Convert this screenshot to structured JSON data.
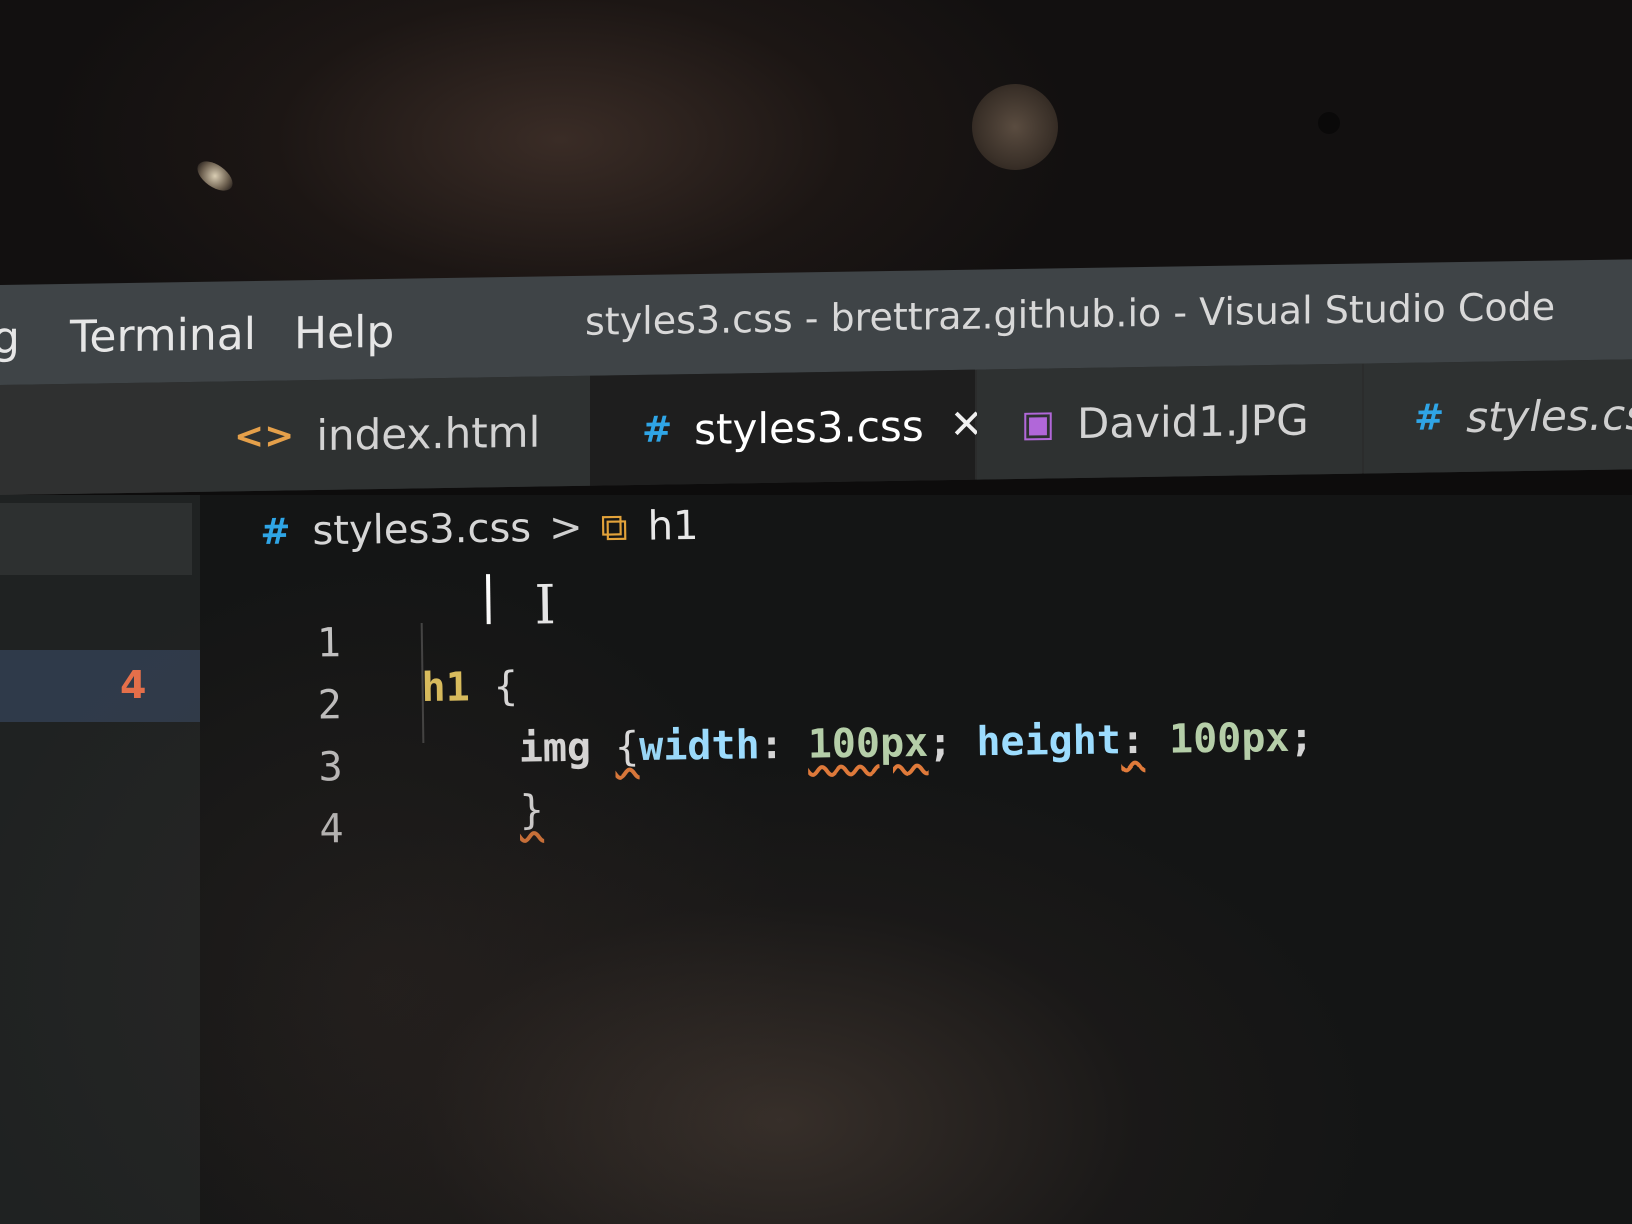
{
  "menu": {
    "items": [
      {
        "label": "g"
      },
      {
        "label": "Terminal"
      },
      {
        "label": "Help"
      }
    ]
  },
  "window": {
    "title": "styles3.css - brettraz.github.io - Visual Studio Code"
  },
  "tabs": [
    {
      "label": "index.html",
      "icon": "<>",
      "icon_name": "html-file-icon",
      "active": false
    },
    {
      "label": "styles3.css",
      "icon": "#",
      "icon_name": "css-file-icon",
      "active": true,
      "close_glyph": "✕"
    },
    {
      "label": "David1.JPG",
      "icon": "▣",
      "icon_name": "image-file-icon",
      "active": false
    },
    {
      "label": "styles.css",
      "icon": "#",
      "icon_name": "css-file-icon",
      "active": false,
      "preview": true
    }
  ],
  "sidebar": {
    "badge": "4"
  },
  "breadcrumb": {
    "icon": "#",
    "file": "styles3.css",
    "separator": ">",
    "symbol_icon": "⧉",
    "symbol": "h1"
  },
  "editor": {
    "lines": [
      {
        "number": "1",
        "selector": "h1",
        "brace": "{"
      },
      {
        "number": "2",
        "selector": "img",
        "brace": "{",
        "prop1": "width",
        "colon1": ":",
        "val1": "100px",
        "semi1": ";",
        "prop2": "height",
        "colon2": ":",
        "val2": "100px",
        "semi2": ";"
      },
      {
        "number": "3",
        "brace": "}"
      },
      {
        "number": "4"
      }
    ],
    "ibeam_glyph": "I"
  },
  "colors": {
    "css_icon": "#2fa5e6",
    "html_icon": "#e5a04a",
    "image_icon": "#b167d9",
    "selector": "#e3c560",
    "property": "#9cdcfe",
    "number": "#b5cea8",
    "error_squiggle": "#e07a3a",
    "badge": "#e8704a"
  }
}
